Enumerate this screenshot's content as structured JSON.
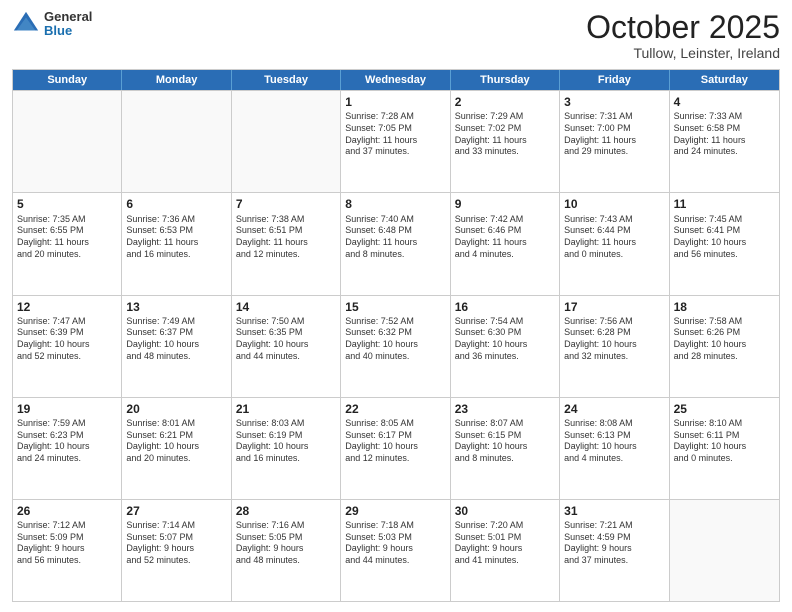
{
  "logo": {
    "general": "General",
    "blue": "Blue"
  },
  "title": "October 2025",
  "location": "Tullow, Leinster, Ireland",
  "days": [
    "Sunday",
    "Monday",
    "Tuesday",
    "Wednesday",
    "Thursday",
    "Friday",
    "Saturday"
  ],
  "weeks": [
    [
      {
        "day": "",
        "empty": true,
        "text": ""
      },
      {
        "day": "",
        "empty": true,
        "text": ""
      },
      {
        "day": "",
        "empty": true,
        "text": ""
      },
      {
        "day": "1",
        "text": "Sunrise: 7:28 AM\nSunset: 7:05 PM\nDaylight: 11 hours\nand 37 minutes."
      },
      {
        "day": "2",
        "text": "Sunrise: 7:29 AM\nSunset: 7:02 PM\nDaylight: 11 hours\nand 33 minutes."
      },
      {
        "day": "3",
        "text": "Sunrise: 7:31 AM\nSunset: 7:00 PM\nDaylight: 11 hours\nand 29 minutes."
      },
      {
        "day": "4",
        "text": "Sunrise: 7:33 AM\nSunset: 6:58 PM\nDaylight: 11 hours\nand 24 minutes."
      }
    ],
    [
      {
        "day": "5",
        "text": "Sunrise: 7:35 AM\nSunset: 6:55 PM\nDaylight: 11 hours\nand 20 minutes."
      },
      {
        "day": "6",
        "text": "Sunrise: 7:36 AM\nSunset: 6:53 PM\nDaylight: 11 hours\nand 16 minutes."
      },
      {
        "day": "7",
        "text": "Sunrise: 7:38 AM\nSunset: 6:51 PM\nDaylight: 11 hours\nand 12 minutes."
      },
      {
        "day": "8",
        "text": "Sunrise: 7:40 AM\nSunset: 6:48 PM\nDaylight: 11 hours\nand 8 minutes."
      },
      {
        "day": "9",
        "text": "Sunrise: 7:42 AM\nSunset: 6:46 PM\nDaylight: 11 hours\nand 4 minutes."
      },
      {
        "day": "10",
        "text": "Sunrise: 7:43 AM\nSunset: 6:44 PM\nDaylight: 11 hours\nand 0 minutes."
      },
      {
        "day": "11",
        "text": "Sunrise: 7:45 AM\nSunset: 6:41 PM\nDaylight: 10 hours\nand 56 minutes."
      }
    ],
    [
      {
        "day": "12",
        "text": "Sunrise: 7:47 AM\nSunset: 6:39 PM\nDaylight: 10 hours\nand 52 minutes."
      },
      {
        "day": "13",
        "text": "Sunrise: 7:49 AM\nSunset: 6:37 PM\nDaylight: 10 hours\nand 48 minutes."
      },
      {
        "day": "14",
        "text": "Sunrise: 7:50 AM\nSunset: 6:35 PM\nDaylight: 10 hours\nand 44 minutes."
      },
      {
        "day": "15",
        "text": "Sunrise: 7:52 AM\nSunset: 6:32 PM\nDaylight: 10 hours\nand 40 minutes."
      },
      {
        "day": "16",
        "text": "Sunrise: 7:54 AM\nSunset: 6:30 PM\nDaylight: 10 hours\nand 36 minutes."
      },
      {
        "day": "17",
        "text": "Sunrise: 7:56 AM\nSunset: 6:28 PM\nDaylight: 10 hours\nand 32 minutes."
      },
      {
        "day": "18",
        "text": "Sunrise: 7:58 AM\nSunset: 6:26 PM\nDaylight: 10 hours\nand 28 minutes."
      }
    ],
    [
      {
        "day": "19",
        "text": "Sunrise: 7:59 AM\nSunset: 6:23 PM\nDaylight: 10 hours\nand 24 minutes."
      },
      {
        "day": "20",
        "text": "Sunrise: 8:01 AM\nSunset: 6:21 PM\nDaylight: 10 hours\nand 20 minutes."
      },
      {
        "day": "21",
        "text": "Sunrise: 8:03 AM\nSunset: 6:19 PM\nDaylight: 10 hours\nand 16 minutes."
      },
      {
        "day": "22",
        "text": "Sunrise: 8:05 AM\nSunset: 6:17 PM\nDaylight: 10 hours\nand 12 minutes."
      },
      {
        "day": "23",
        "text": "Sunrise: 8:07 AM\nSunset: 6:15 PM\nDaylight: 10 hours\nand 8 minutes."
      },
      {
        "day": "24",
        "text": "Sunrise: 8:08 AM\nSunset: 6:13 PM\nDaylight: 10 hours\nand 4 minutes."
      },
      {
        "day": "25",
        "text": "Sunrise: 8:10 AM\nSunset: 6:11 PM\nDaylight: 10 hours\nand 0 minutes."
      }
    ],
    [
      {
        "day": "26",
        "text": "Sunrise: 7:12 AM\nSunset: 5:09 PM\nDaylight: 9 hours\nand 56 minutes."
      },
      {
        "day": "27",
        "text": "Sunrise: 7:14 AM\nSunset: 5:07 PM\nDaylight: 9 hours\nand 52 minutes."
      },
      {
        "day": "28",
        "text": "Sunrise: 7:16 AM\nSunset: 5:05 PM\nDaylight: 9 hours\nand 48 minutes."
      },
      {
        "day": "29",
        "text": "Sunrise: 7:18 AM\nSunset: 5:03 PM\nDaylight: 9 hours\nand 44 minutes."
      },
      {
        "day": "30",
        "text": "Sunrise: 7:20 AM\nSunset: 5:01 PM\nDaylight: 9 hours\nand 41 minutes."
      },
      {
        "day": "31",
        "text": "Sunrise: 7:21 AM\nSunset: 4:59 PM\nDaylight: 9 hours\nand 37 minutes."
      },
      {
        "day": "",
        "empty": true,
        "text": ""
      }
    ]
  ]
}
